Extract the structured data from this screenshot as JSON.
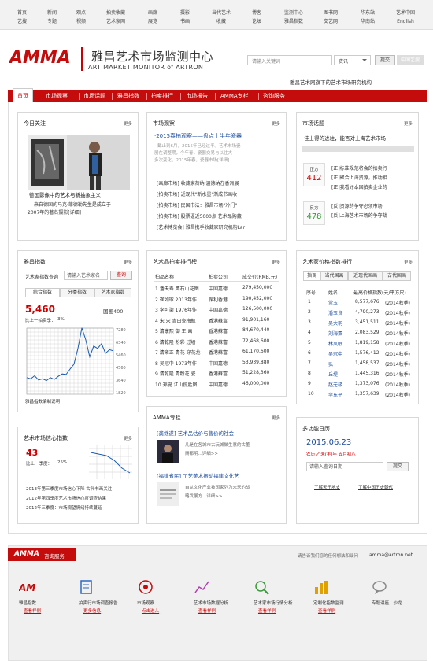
{
  "topnav": [
    {
      "a": "首页",
      "b": "艺搜"
    },
    {
      "a": "新闻",
      "b": "专题"
    },
    {
      "a": "观点",
      "b": "视频"
    },
    {
      "a": "拍卖收藏",
      "b": "艺术家网"
    },
    {
      "a": "画廊",
      "b": "展览"
    },
    {
      "a": "摄影",
      "b": "书画"
    },
    {
      "a": "当代艺术",
      "b": "收藏"
    },
    {
      "a": "博客",
      "b": "论坛"
    },
    {
      "a": "监测中心",
      "b": "雅昌指数"
    },
    {
      "a": "图书网",
      "b": "交艺网"
    },
    {
      "a": "华东站",
      "b": "华南站"
    },
    {
      "a": "艺术中国",
      "b": "English"
    }
  ],
  "header": {
    "logo_text": "AMMA",
    "title": "雅昌艺术市场监测中心",
    "subtitle": "ART MARKET MONITOR of ARTRON",
    "search_placeholder": "请输入关键词",
    "search_scope": "资讯",
    "submit": "提交",
    "china_art": "中国艺搜",
    "slogan": "雅昌艺术网旗下的艺术市场研究机构"
  },
  "mainnav": [
    "首页",
    "市场观察",
    "市场话题",
    "雅昌指数",
    "拍卖排行",
    "市场报告",
    "AMMA专栏",
    "咨询服务"
  ],
  "today": {
    "title": "今日关注",
    "more": "更多",
    "headline": "德国影像中的艺术与新抽象主义",
    "body1": "来自德国的马克·菲德勒先生是成立于",
    "body2": "2007年的著名摄影[详细]"
  },
  "market": {
    "title": "市场观察",
    "more": "更多",
    "headline": "·2015春拍观察——盘点上半年瓷器",
    "para": [
      "截止到6月，2015年已经过半。艺术市场瓷",
      "器在调整期，今年春，瓷器交易与以往大",
      "多次变化，2015年春，瓷器市场[详细]"
    ],
    "items": [
      "[画廊市场] 收藏家荷纳·温德纳在香洲展",
      "[拍卖市场] 近现代\"新水墨\"渐成书画收",
      "[拍卖市场] 民国书法：雅昌市场\"冷门\"",
      "[拍卖市场] 股票逼近5000点 艺术品购藏",
      "[艺术博览会] 雅昌携手收藏家研究机构Lar"
    ]
  },
  "topic": {
    "title": "市场话题",
    "more": "更多",
    "headline": "佳士得的进驻，能否对上海艺术市场",
    "pro_label": "正方",
    "pro_count": "412",
    "con_label": "反方",
    "con_count": "478",
    "pro_items": [
      "[正]标准规范将会的拍卖行",
      "[正]聚合上海资源，推动相",
      "[正]我看好本国拍卖企业的"
    ],
    "con_items": [
      "[反]资源的争夺必须市场",
      "[反]上海艺术市场的争夺战"
    ]
  },
  "index": {
    "title": "雅昌指数",
    "more": "更多",
    "artist_label": "艺术家指数查询",
    "artist_placeholder": "请输入艺术家名",
    "query": "查询",
    "tabs": [
      "综合指数",
      "分类指数",
      "艺术家指数"
    ],
    "value": "5,460",
    "change_label": "比上一拍卖季：",
    "change": "3%",
    "market_name": "国画400",
    "y_ticks": [
      "7280",
      "6340",
      "5460",
      "4560",
      "3640",
      "1820"
    ],
    "link": "雅昌指数编制说明"
  },
  "chart_data": {
    "type": "line",
    "ylim": [
      1820,
      7280
    ],
    "values": [
      3200,
      3100,
      3350,
      3000,
      3100,
      2950,
      3200,
      3050,
      3300,
      3500,
      3450,
      3900,
      4300,
      5600,
      7300,
      6300,
      4900,
      5800,
      5600,
      6000,
      5200,
      5500,
      5400
    ]
  },
  "ranking": {
    "title": "艺术品拍卖排行榜",
    "more": "更多",
    "headers": [
      "拍品名称",
      "拍卖公司",
      "成交价(RMB,元)"
    ],
    "rows": [
      [
        "1 潘天寿 鹰石山花图",
        "中国嘉德",
        "279,450,000"
      ],
      [
        "2 崔如琢 2013年作",
        "保利香港",
        "190,452,000"
      ],
      [
        "3 李可染 1976年作",
        "中国嘉德",
        "126,500,000"
      ],
      [
        "4 宋 宋 青白瓷梅瓶",
        "香港蘇富",
        "91,901,160"
      ],
      [
        "5 清康熙 御 王 画",
        "香港蘇富",
        "84,670,440"
      ],
      [
        "6 清乾隆 粉彩 过墙",
        "香港蘇富",
        "72,468,600"
      ],
      [
        "7 清雍正 青花 穿花龙",
        "香港蘇富",
        "61,170,600"
      ],
      [
        "8 吴冠中 1973年作",
        "中国嘉德",
        "53,939,880"
      ],
      [
        "9 清乾隆 青粉花 瓷",
        "香港蘇富",
        "51,228,360"
      ],
      [
        "10 郑燮 江山揽胜图",
        "中国嘉德",
        "46,000,000"
      ]
    ]
  },
  "artist_rank": {
    "title": "艺术家价格指数排行",
    "more": "更多",
    "tabs": [
      "指调",
      "当代国画",
      "近现代国画",
      "古代国画"
    ],
    "headers": [
      "序号",
      "姓名",
      "最高价格指数(元/平方尺)"
    ],
    "rows": [
      [
        "1",
        "常玉",
        "8,577,676",
        "(2014秋季)"
      ],
      [
        "2",
        "潘玉良",
        "4,790,273",
        "(2014秋季)"
      ],
      [
        "3",
        "吴大羽",
        "3,451,511",
        "(2014秋季)"
      ],
      [
        "4",
        "刘海粟",
        "2,083,529",
        "(2014秋季)"
      ],
      [
        "5",
        "林风眠",
        "1,819,158",
        "(2014秋季)"
      ],
      [
        "6",
        "吴冠中",
        "1,576,412",
        "(2014秋季)"
      ],
      [
        "7",
        "弘一",
        "1,458,537",
        "(2014秋季)"
      ],
      [
        "8",
        "丘堤",
        "1,445,316",
        "(2014秋季)"
      ],
      [
        "9",
        "赵无极",
        "1,373,076",
        "(2014秋季)"
      ],
      [
        "10",
        "李东平",
        "1,357,639",
        "(2014秋季)"
      ]
    ]
  },
  "confidence": {
    "title": "艺术市场信心指数",
    "more": "更多",
    "value": "43",
    "change_label": "比上一季度：",
    "change": "25%",
    "items": [
      "2013年第三季度市场信心下降 古代书画关注",
      "2012年第四季度艺术市场信心度调查结果",
      "2012年三季度：市场观望情绪持续蔓延"
    ]
  },
  "amma_col": {
    "title": "AMMA专栏",
    "more": "更多",
    "a1_title": "[龚继遂] 艺术品估价与售价的社会",
    "a1_body": [
      "凡是在各城市古玩城做生意的古董",
      "商都明...详细>>"
    ],
    "a2_title": "[福建省民] 工艺美术振动福建文化艺",
    "a2_body": [
      "自从文化产业被国家列为未来的战",
      "略发展方...详细>>"
    ]
  },
  "calendar": {
    "title": "多功能日历",
    "date": "2015.06.23",
    "lunar": "农历 乙未(羊)年 五月初八",
    "placeholder": "请输入查询日期",
    "submit": "提交",
    "link1": "了解天干地支",
    "link2": "了解中国历史朝代"
  },
  "service": {
    "logo_text": "AMMA",
    "label": "咨询服务",
    "contact": "请告诉我们您的任何想法和疑问",
    "email": "amma@artron.net",
    "items": [
      {
        "name": "雅昌指数",
        "link": "查看样例"
      },
      {
        "name": "拍卖行市场调查报告",
        "link": "更多信息"
      },
      {
        "name": "市场观察",
        "link": "点击进入"
      },
      {
        "name": "艺术市场数据分析",
        "link": "查看样例"
      },
      {
        "name": "艺术家市场行情分析",
        "link": "查看样例"
      },
      {
        "name": "定制化指数监测",
        "link": "查看样例"
      },
      {
        "name": "专题讲座，沙龙",
        "link": ""
      }
    ]
  },
  "colors": {
    "brand": "#c40c0c",
    "accent_green": "#3a9a3a"
  }
}
